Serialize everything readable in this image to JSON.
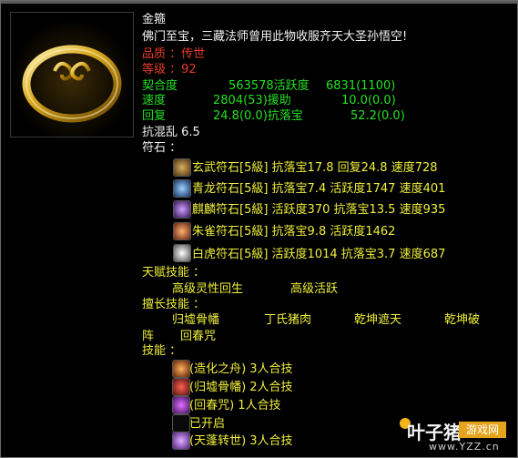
{
  "item": {
    "name": "金箍",
    "desc": "佛门至宝，三藏法师曾用此物收服齐天大圣孙悟空!",
    "quality": "品质 ：传世",
    "level": "等级 ：92"
  },
  "stats": {
    "row1a": "契合度",
    "row1b": "563578活跃度",
    "row1c": "6831(1100)",
    "row2a": "速度",
    "row2b": "2804(53)援助",
    "row2c": "10.0(0.0)",
    "row3a": "回复",
    "row3b": "24.8(0.0)抗落宝",
    "row3c": "52.2(0.0)",
    "row4": "抗混乱 6.5"
  },
  "runes": {
    "title": "符石 ：",
    "items": [
      {
        "text": "玄武符石[5級] 抗落宝17.8 回复24.8 速度728",
        "icon": "xuanwu-rune-icon"
      },
      {
        "text": "青龙符石[5級] 抗落宝7.4 活跃度1747 速度401",
        "icon": "qinglong-rune-icon"
      },
      {
        "text": "麒麟符石[5級] 活跃度370 抗落宝13.5 速度935",
        "icon": "qilin-rune-icon"
      },
      {
        "text": "朱雀符石[5級] 抗落宝9.8 活跃度1462",
        "icon": "zhuque-rune-icon"
      },
      {
        "text": "白虎符石[5級] 活跃度1014 抗落宝3.7 速度687",
        "icon": "baihu-rune-icon"
      }
    ]
  },
  "talent": {
    "title": "天赋技能 ：",
    "skill1": "高级灵性回生",
    "skill2": "高级活跃"
  },
  "specialty": {
    "title": "擅长技能 ：",
    "s1": "归墟骨幡",
    "s2": "丁氏猪肉",
    "s3": "乾坤遮天",
    "s4": "乾坤破",
    "s4b": "阵",
    "s5": "回春咒"
  },
  "skills": {
    "title": "技能 ：",
    "items": [
      {
        "text": "(造化之舟) 3人合技",
        "icon": "zaohua-skill-icon"
      },
      {
        "text": "(归墟骨幡) 2人合技",
        "icon": "guixu-skill-icon"
      },
      {
        "text": "(回春咒) 1人合技",
        "icon": "huichun-skill-icon"
      },
      {
        "text": "已开启",
        "icon": "opened-skill-icon"
      },
      {
        "text": "(天蓬转世) 3人合技",
        "icon": "tianpeng-skill-icon"
      }
    ]
  },
  "watermark": {
    "logo": "叶子猪",
    "box": "游戏网",
    "url": "www.YZZ.cn"
  }
}
